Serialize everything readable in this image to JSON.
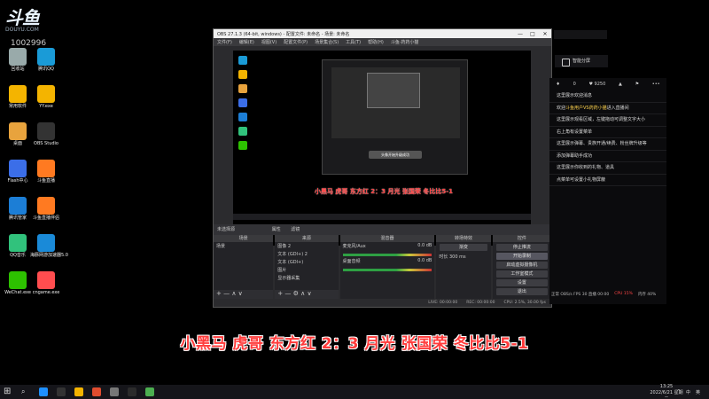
{
  "logo": {
    "mark": "斗鱼",
    "sub": "DOUYU.COM"
  },
  "counter": "1002996",
  "desktop": {
    "icons": [
      {
        "label": "回收站",
        "color": "#9aa"
      },
      {
        "label": "腾讯QQ",
        "color": "#1a9bd7"
      },
      {
        "label": "常用软件",
        "color": "#f4b400"
      },
      {
        "label": "YY.exe",
        "color": "#f4b400"
      },
      {
        "label": "桌面",
        "color": "#e8a33d"
      },
      {
        "label": "OBS Studio",
        "color": "#333"
      },
      {
        "label": "Flash中心",
        "color": "#3b6ee8"
      },
      {
        "label": "斗鱼直播",
        "color": "#ff7a21"
      },
      {
        "label": "腾讯管家",
        "color": "#1c7ed6"
      },
      {
        "label": "斗鱼直播伴侣",
        "color": "#ff7a21"
      },
      {
        "label": "QQ音乐",
        "color": "#31c27c"
      },
      {
        "label": "海豚网游加速器5.0",
        "color": "#1a8ad8"
      },
      {
        "label": "WeChat.exe",
        "color": "#2dc100"
      },
      {
        "label": "cngame.exe",
        "color": "#ff4d4f"
      }
    ]
  },
  "obs": {
    "title": "OBS 27.1.3 (64-bit, windows) - 配置文件: 未命名 - 场景: 未命名",
    "menu": [
      "文件(F)",
      "编辑(E)",
      "视图(V)",
      "配置文件(P)",
      "场景集合(S)",
      "工具(T)",
      "帮助(H)",
      "斗鱼·药药小猫"
    ],
    "window_buttons": [
      "—",
      "□",
      "✕"
    ],
    "preview_toast": "头像开始升级成功",
    "preview_ticker": "小黑马 虎哥 东方红 2：3 月光 张国荣 冬比比5-1",
    "scene_label": "未选择源",
    "scene_tabs": [
      "属性",
      "滤镜"
    ],
    "docks": {
      "scenes": {
        "title": "场景",
        "rows": [
          "场景"
        ]
      },
      "sources": {
        "title": "来源",
        "rows": [
          "图像 2",
          "文本 (GDI+) 2",
          "文本 (GDI+)",
          "图片",
          "显示器采集"
        ]
      },
      "mixer": {
        "title": "混音器",
        "rows": [
          "麦克风/Aux",
          "桌面音频"
        ],
        "levels": [
          "0.0 dB",
          "0.0 dB"
        ]
      },
      "transitions": {
        "title": "转场特效",
        "mode": "渐变",
        "duration_label": "时长",
        "duration": "300 ms"
      },
      "controls": {
        "title": "控件",
        "buttons": [
          "停止推流",
          "开始录制",
          "启动虚拟摄像机",
          "工作室模式",
          "设置",
          "退出"
        ]
      }
    },
    "status": [
      "LIVE: 00:00:00",
      "REC: 00:00:00",
      "CPU: 2.5%, 30.00 fps"
    ]
  },
  "chat": {
    "top": [
      "♦",
      "0",
      "♥ 9250",
      "▲",
      "⚑",
      "•••"
    ],
    "messages": [
      {
        "text": "这里展示欢迎消息"
      },
      {
        "pre": "欢迎",
        "hl": "斗鱼用户VS药药小猫",
        "post": "进入直播间"
      },
      {
        "text": "这里展示观看区域，左键拖动可调整文字大小"
      },
      {
        "text": "右上角有设置菜单"
      },
      {
        "text": "这里展示弹幕、贵族开通/续费、粉丝牌升级等"
      },
      {
        "text": "添加弹幕助手成功"
      },
      {
        "text": "这里展示你收到的礼物、道具"
      },
      {
        "text": "点菜单可设置小礼物屏蔽"
      }
    ],
    "stats": [
      "正常 OBS/s FPS 30 直播 00:00",
      "CPU 15%",
      "内存 40%"
    ]
  },
  "smart_label": "智能分屏",
  "caption": "小黑马 虎哥 东方红 2：3 月光 张国荣 冬比比5-1",
  "clock": {
    "time": "13:25",
    "date": "2022/6/21 星期二"
  },
  "taskbar": {
    "apps": [
      "#1e90ff",
      "#333",
      "#f4b400",
      "#e04d2f",
      "#777",
      "#2b2b2b",
      "#4caf50"
    ],
    "tray": [
      "^",
      "中",
      "英"
    ]
  }
}
